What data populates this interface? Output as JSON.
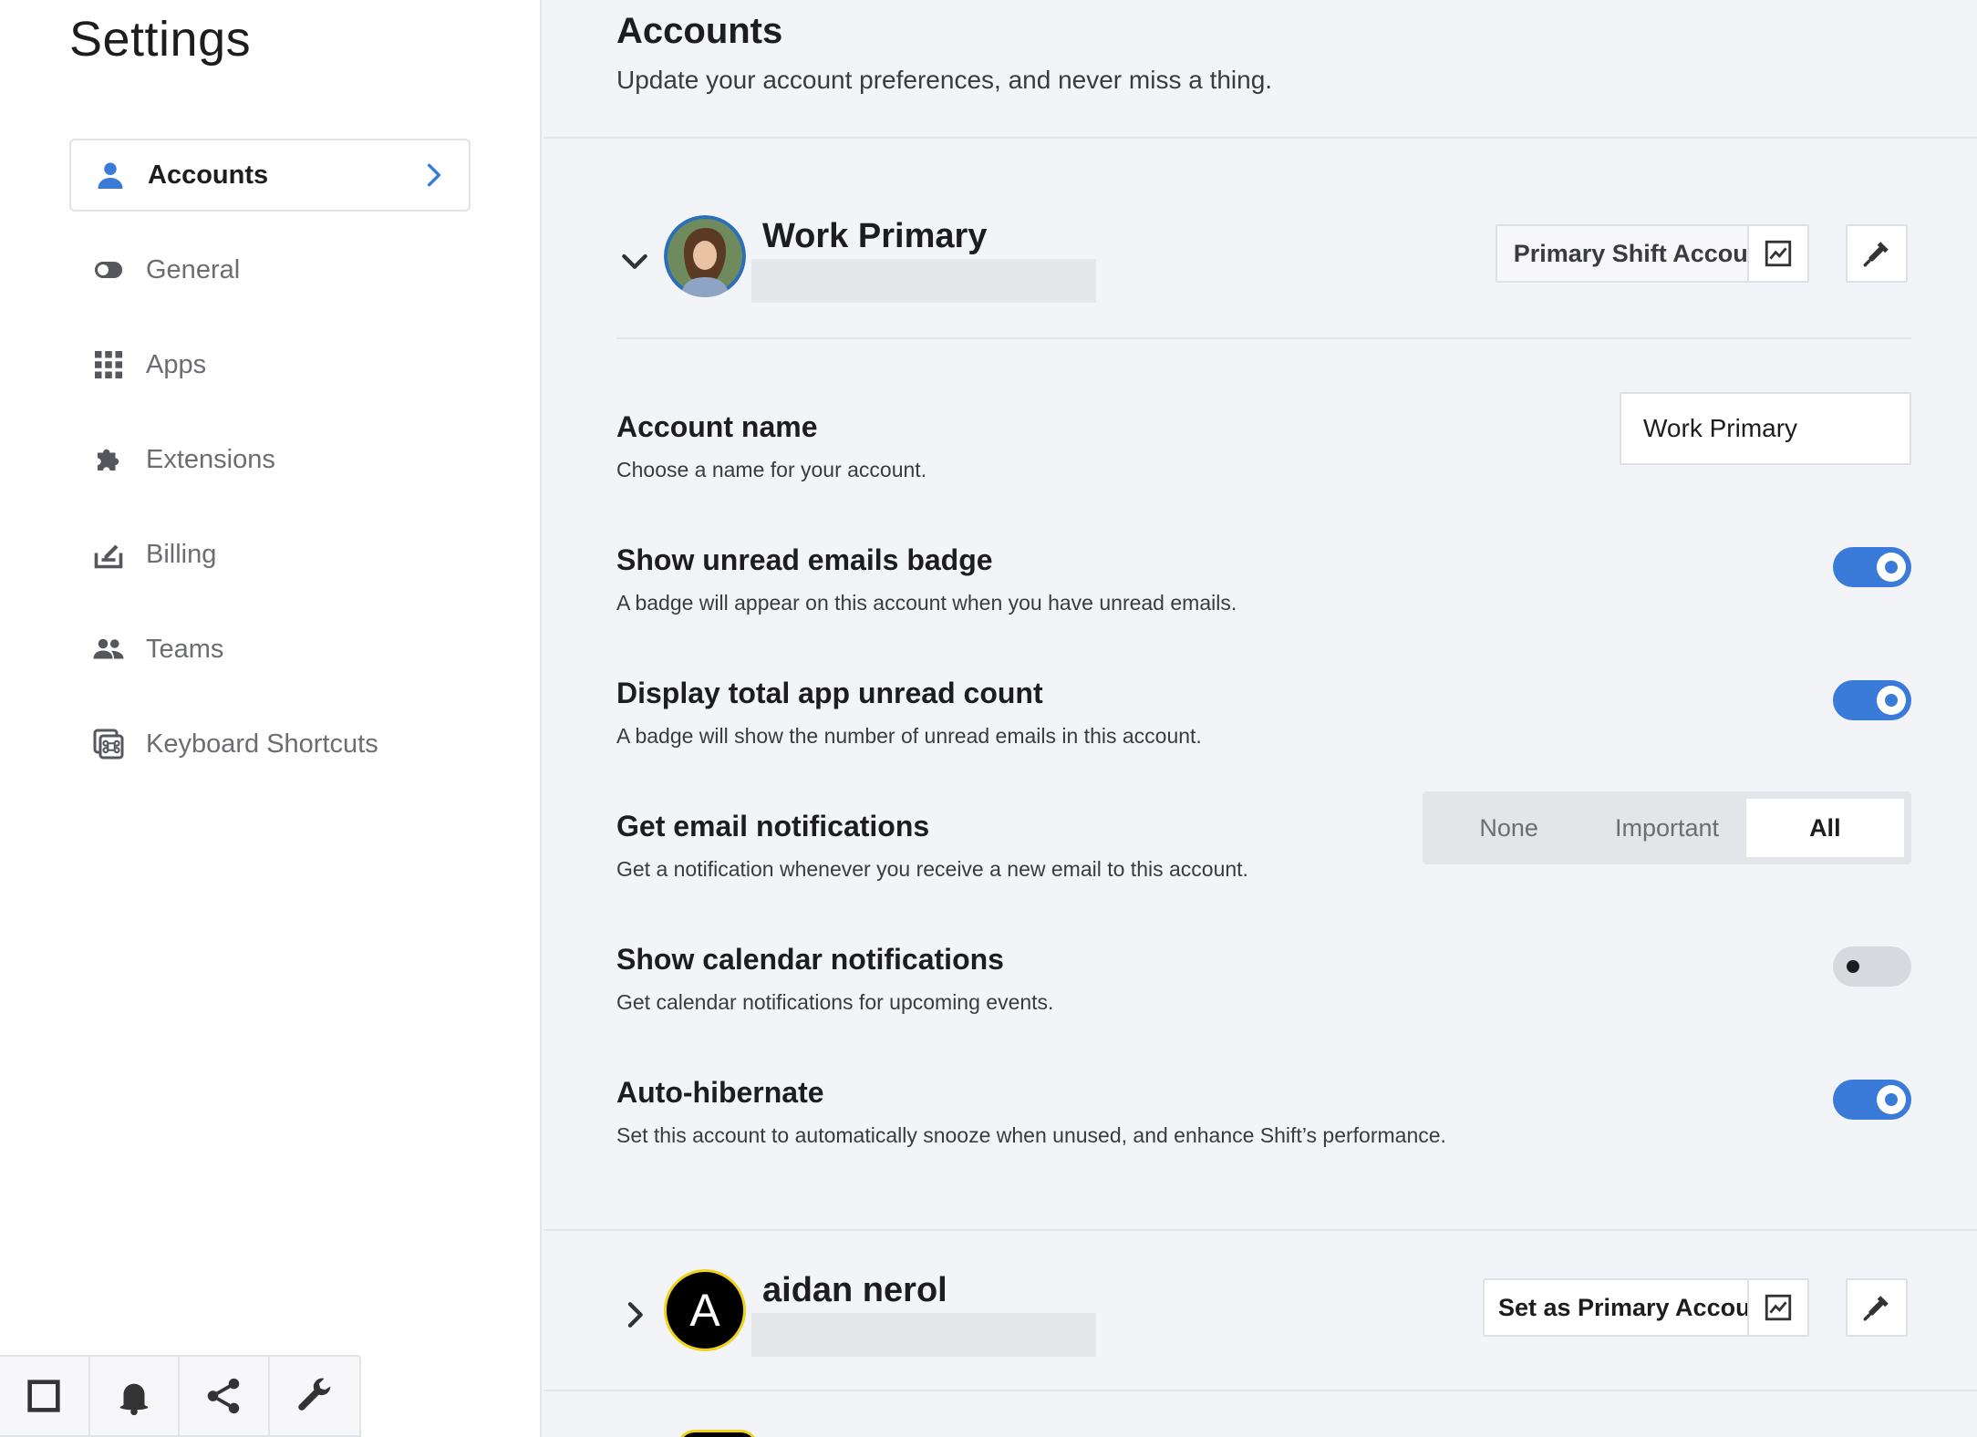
{
  "sidebar": {
    "title": "Settings",
    "items": [
      {
        "label": "Accounts",
        "icon": "person-icon",
        "active": true
      },
      {
        "label": "General",
        "icon": "toggle-icon"
      },
      {
        "label": "Apps",
        "icon": "grid-icon"
      },
      {
        "label": "Extensions",
        "icon": "puzzle-icon"
      },
      {
        "label": "Billing",
        "icon": "billing-icon"
      },
      {
        "label": "Teams",
        "icon": "people-icon"
      },
      {
        "label": "Keyboard Shortcuts",
        "icon": "keyboard-command-icon"
      }
    ]
  },
  "bottom_bar": {
    "icons": [
      "square-icon",
      "bell-icon",
      "share-icon",
      "wrench-icon"
    ]
  },
  "header": {
    "title": "Accounts",
    "subtitle": "Update your account preferences, and never miss a thing."
  },
  "account1": {
    "name": "Work Primary",
    "primary_label": "Primary Shift Account",
    "expanded": true
  },
  "settings": {
    "account_name": {
      "title": "Account name",
      "desc": "Choose a name for your account.",
      "value": "Work Primary"
    },
    "unread_badge": {
      "title": "Show unread emails badge",
      "desc": "A badge will appear on this account when you have unread emails.",
      "on": true
    },
    "unread_count": {
      "title": "Display total app unread count",
      "desc": "A badge will show the number of unread emails in this account.",
      "on": true
    },
    "email_notifications": {
      "title": "Get email notifications",
      "desc": "Get a notification whenever you receive a new email to this account.",
      "options": [
        "None",
        "Important",
        "All"
      ],
      "selected": "All"
    },
    "calendar_notifications": {
      "title": "Show calendar notifications",
      "desc": "Get calendar notifications for upcoming events.",
      "on": false
    },
    "auto_hibernate": {
      "title": "Auto-hibernate",
      "desc": "Set this account to automatically snooze when unused, and enhance Shift’s performance.",
      "on": true
    }
  },
  "account2": {
    "name": "aidan nerol",
    "avatar_letter": "A",
    "primary_label": "Set as Primary Account",
    "expanded": false
  },
  "colors": {
    "accent": "#3a7bd9",
    "avatar_ring": "#f0d21a"
  }
}
